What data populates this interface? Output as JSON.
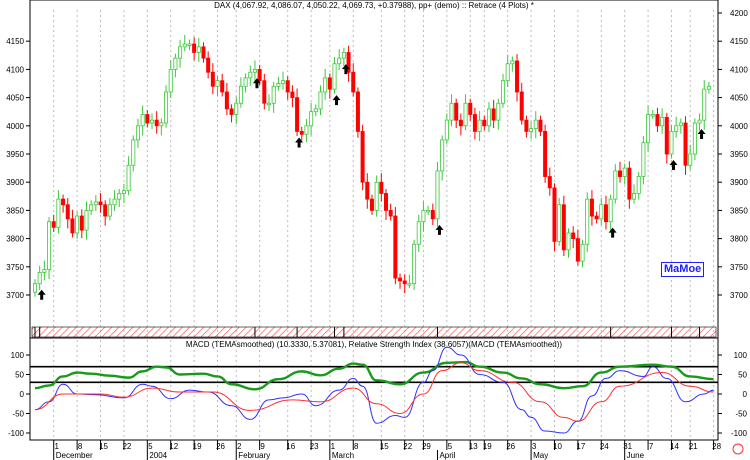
{
  "title": "DAX (4,067.92, 4,086.07, 4,050.22, 4,069.73, +0.37988), pp+ (demo) :: Retrace (4 Plots) *",
  "indicator_title": "MACD (TEMAsmoothed) (10.3330, 5.37081), Relative Strength Index (38.6057)(MACD (TEMAsmoothed))",
  "watermark": "MaMoe",
  "colors": {
    "up": "#3cc83c",
    "down": "#ff0000",
    "macd": "#3030ff",
    "signal": "#ff3030",
    "rsi": "#1a9a1a",
    "arrow": "#000000",
    "hatch": "#ff6060"
  },
  "chart_data": [
    {
      "type": "candlestick",
      "title": "DAX",
      "ylim": [
        3650,
        4200
      ],
      "yticks_left": [
        3700,
        3750,
        3800,
        3850,
        3900,
        3950,
        4000,
        4050,
        4100,
        4150
      ],
      "yticks_right": [
        3700,
        3750,
        3800,
        3850,
        3900,
        3950,
        4000,
        4050,
        4100,
        4150,
        4200
      ],
      "close": [
        3720,
        3740,
        3745,
        3830,
        3820,
        3870,
        3860,
        3835,
        3810,
        3840,
        3815,
        3850,
        3860,
        3865,
        3860,
        3840,
        3860,
        3870,
        3880,
        3885,
        3930,
        3975,
        4000,
        4020,
        4005,
        4010,
        4000,
        4005,
        4060,
        4100,
        4120,
        4140,
        4145,
        4145,
        4130,
        4140,
        4120,
        4095,
        4070,
        4080,
        4060,
        4030,
        4020,
        4040,
        4070,
        4085,
        4095,
        4100,
        4080,
        4040,
        4040,
        4070,
        4075,
        4080,
        4060,
        4050,
        3990,
        3985,
        4000,
        4025,
        4030,
        4060,
        4085,
        4065,
        4110,
        4120,
        4130,
        4095,
        4060,
        3990,
        3900,
        3870,
        3850,
        3900,
        3880,
        3850,
        3840,
        3730,
        3725,
        3720,
        3720,
        3790,
        3830,
        3850,
        3850,
        3835,
        3920,
        3975,
        4010,
        4040,
        4010,
        4000,
        4040,
        4020,
        3990,
        4010,
        4000,
        4030,
        4010,
        4040,
        4080,
        4110,
        4115,
        4060,
        4010,
        3990,
        3995,
        4010,
        3990,
        3910,
        3890,
        3795,
        3860,
        3780,
        3810,
        3800,
        3760,
        3790,
        3870,
        3840,
        3835,
        3860,
        3830,
        3870,
        3920,
        3910,
        3925,
        3870,
        3880,
        3910,
        3970,
        4020,
        4020,
        4000,
        4015,
        3950,
        3990,
        4000,
        4005,
        3930,
        3950,
        4005,
        4010,
        4065,
        4070
      ],
      "retrace_arrows_day_index": [
        1,
        47,
        56,
        64,
        66,
        86,
        123,
        136,
        142
      ]
    },
    {
      "type": "line",
      "title": "MACD (TEMAsmoothed) / RSI",
      "ylim": [
        -120,
        130
      ],
      "yticks": [
        -100,
        -50,
        0,
        50,
        100
      ],
      "reference_lines": [
        30,
        70
      ],
      "series": [
        {
          "name": "RSI",
          "points": [
            [
              0,
              15
            ],
            [
              3,
              22
            ],
            [
              6,
              45
            ],
            [
              9,
              55
            ],
            [
              12,
              52
            ],
            [
              16,
              47
            ],
            [
              20,
              42
            ],
            [
              23,
              58
            ],
            [
              26,
              70
            ],
            [
              28,
              68
            ],
            [
              31,
              50
            ],
            [
              36,
              52
            ],
            [
              39,
              45
            ],
            [
              42,
              25
            ],
            [
              47,
              12
            ],
            [
              52,
              38
            ],
            [
              57,
              58
            ],
            [
              61,
              48
            ],
            [
              65,
              65
            ],
            [
              68,
              78
            ],
            [
              70,
              75
            ],
            [
              73,
              35
            ],
            [
              78,
              25
            ],
            [
              83,
              55
            ],
            [
              88,
              80
            ],
            [
              92,
              82
            ],
            [
              95,
              70
            ],
            [
              100,
              55
            ],
            [
              104,
              40
            ],
            [
              108,
              25
            ],
            [
              113,
              15
            ],
            [
              117,
              20
            ],
            [
              121,
              55
            ],
            [
              125,
              70
            ],
            [
              132,
              75
            ],
            [
              136,
              70
            ],
            [
              140,
              45
            ],
            [
              145,
              38
            ]
          ]
        },
        {
          "name": "MACD",
          "points": [
            [
              0,
              -40
            ],
            [
              3,
              -20
            ],
            [
              6,
              25
            ],
            [
              9,
              0
            ],
            [
              13,
              -2
            ],
            [
              19,
              -10
            ],
            [
              23,
              25
            ],
            [
              25,
              20
            ],
            [
              29,
              -12
            ],
            [
              33,
              10
            ],
            [
              37,
              5
            ],
            [
              42,
              -30
            ],
            [
              46,
              -65
            ],
            [
              50,
              -15
            ],
            [
              53,
              -10
            ],
            [
              57,
              0
            ],
            [
              60,
              -30
            ],
            [
              65,
              10
            ],
            [
              68,
              40
            ],
            [
              70,
              20
            ],
            [
              73,
              -75
            ],
            [
              77,
              -55
            ],
            [
              79,
              -60
            ],
            [
              83,
              30
            ],
            [
              85,
              60
            ],
            [
              88,
              120
            ],
            [
              91,
              100
            ],
            [
              95,
              50
            ],
            [
              100,
              30
            ],
            [
              104,
              -40
            ],
            [
              106,
              -60
            ],
            [
              109,
              -95
            ],
            [
              113,
              -100
            ],
            [
              116,
              -70
            ],
            [
              119,
              -5
            ],
            [
              122,
              40
            ],
            [
              125,
              60
            ],
            [
              130,
              45
            ],
            [
              132,
              70
            ],
            [
              135,
              40
            ],
            [
              139,
              -20
            ],
            [
              143,
              0
            ],
            [
              145,
              10
            ]
          ]
        },
        {
          "name": "Signal",
          "points": [
            [
              0,
              -40
            ],
            [
              6,
              0
            ],
            [
              14,
              0
            ],
            [
              19,
              -8
            ],
            [
              25,
              15
            ],
            [
              31,
              5
            ],
            [
              38,
              5
            ],
            [
              46,
              -42
            ],
            [
              55,
              -15
            ],
            [
              61,
              -20
            ],
            [
              68,
              15
            ],
            [
              73,
              -25
            ],
            [
              78,
              -50
            ],
            [
              83,
              0
            ],
            [
              87,
              60
            ],
            [
              91,
              80
            ],
            [
              95,
              60
            ],
            [
              102,
              30
            ],
            [
              108,
              -20
            ],
            [
              113,
              -60
            ],
            [
              116,
              -70
            ],
            [
              121,
              -20
            ],
            [
              125,
              20
            ],
            [
              134,
              55
            ],
            [
              140,
              20
            ],
            [
              145,
              5
            ]
          ]
        }
      ]
    }
  ],
  "x_axis": {
    "day_ticks": [
      [
        "1",
        4
      ],
      [
        "8",
        9
      ],
      [
        "15",
        14
      ],
      [
        "22",
        19
      ],
      [
        "5",
        24
      ],
      [
        "12",
        29
      ],
      [
        "19",
        34
      ],
      [
        "26",
        39
      ],
      [
        "2",
        43
      ],
      [
        "9",
        48
      ],
      [
        "16",
        54
      ],
      [
        "23",
        59
      ],
      [
        "1",
        63
      ],
      [
        "8",
        68
      ],
      [
        "15",
        74
      ],
      [
        "22",
        79
      ],
      [
        "29",
        83
      ],
      [
        "5",
        88
      ],
      [
        "13",
        93
      ],
      [
        "19",
        96
      ],
      [
        "26",
        101
      ],
      [
        "3",
        106
      ],
      [
        "10",
        111
      ],
      [
        "17",
        116
      ],
      [
        "24",
        121
      ],
      [
        "31",
        126
      ],
      [
        "7",
        131
      ],
      [
        "14",
        136
      ],
      [
        "21",
        140
      ],
      [
        "28",
        145
      ]
    ],
    "months": [
      [
        "December",
        4
      ],
      [
        "2004",
        24
      ],
      [
        "February",
        43
      ],
      [
        "March",
        63
      ],
      [
        "April",
        86
      ],
      [
        "May",
        106
      ],
      [
        "June",
        126
      ]
    ]
  }
}
